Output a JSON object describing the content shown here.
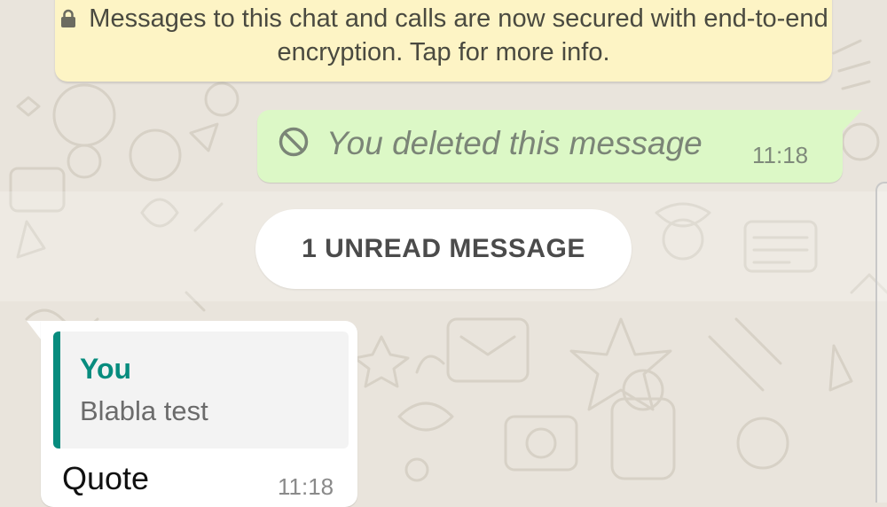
{
  "encryption_notice": {
    "text": "Messages to this chat and calls are now secured with end-to-end encryption. Tap for more info.",
    "icon": "lock-icon"
  },
  "outgoing_message": {
    "text": "You deleted this message",
    "time": "11:18",
    "icon": "blocked-icon"
  },
  "unread_divider": {
    "label": "1 UNREAD MESSAGE"
  },
  "incoming_message": {
    "quoted": {
      "author": "You",
      "text": "Blabla test"
    },
    "text": "Quote",
    "time": "11:18"
  },
  "colors": {
    "wallpaper": "#e9e4dc",
    "notice_bg": "#fdf4c5",
    "outgoing_bubble": "#dcf8c6",
    "accent_teal": "#078c7e",
    "incoming_bubble": "#ffffff"
  }
}
